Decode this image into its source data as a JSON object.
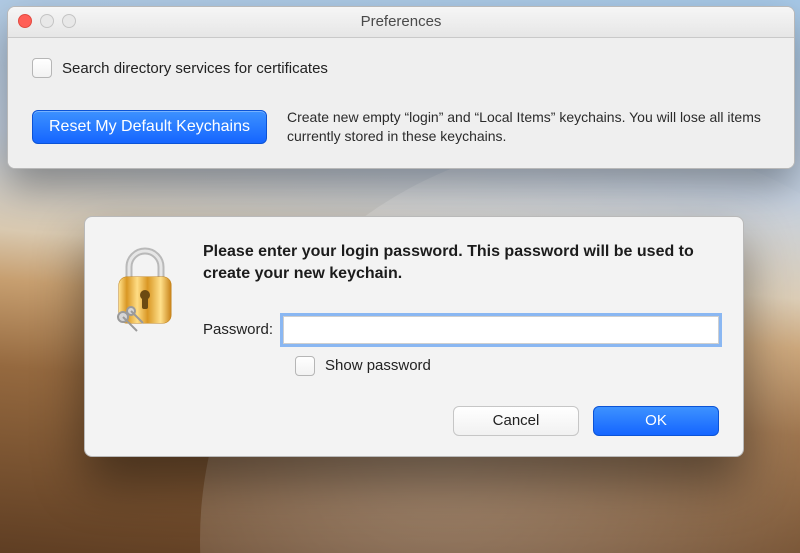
{
  "window": {
    "title": "Preferences"
  },
  "prefs": {
    "search_checkbox_label": "Search directory services for certificates",
    "reset_button_label": "Reset My Default Keychains",
    "reset_description": "Create new empty “login” and “Local Items” keychains. You will lose all items currently stored in these keychains."
  },
  "dialog": {
    "heading": "Please enter your login password. This password will be used to create your new keychain.",
    "password_label": "Password:",
    "password_value": "",
    "show_password_label": "Show password",
    "cancel_label": "Cancel",
    "ok_label": "OK"
  },
  "icons": {
    "lock": "lock-icon"
  }
}
